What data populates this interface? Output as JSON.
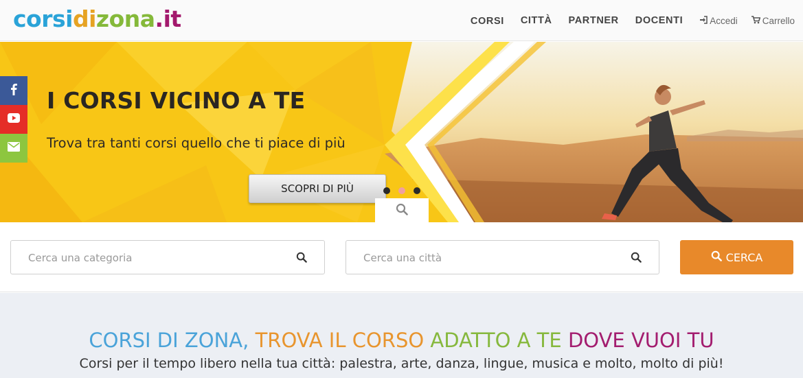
{
  "header": {
    "logo_parts": [
      "corsi",
      "di",
      "zona",
      ".it"
    ],
    "nav": [
      "CORSI",
      "CITTÀ",
      "PARTNER",
      "DOCENTI"
    ],
    "login_label": "Accedi",
    "cart_label": "Carrello"
  },
  "hero": {
    "title": "I CORSI VICINO A TE",
    "subtitle": "Trova tra tanti corsi quello che ti piace di più",
    "button": "SCOPRI DI PIÙ",
    "slide_count": 3,
    "active_slide": 2
  },
  "social": {
    "icons": [
      "facebook-icon",
      "youtube-icon",
      "mail-icon"
    ],
    "colors": [
      "#3b5998",
      "#e52d27",
      "#8dc63f"
    ]
  },
  "search": {
    "category_placeholder": "Cerca una categoria",
    "city_placeholder": "Cerca una città",
    "button": "CERCA",
    "button_color": "#e8892a"
  },
  "intro": {
    "title_parts": [
      "CORSI DI ZONA, ",
      "TROVA IL CORSO ",
      "ADATTO A TE ",
      "DOVE VUOI TU"
    ],
    "subtitle": "Corsi per il tempo libero nella tua città: palestra, arte, danza, lingue, musica e molto, molto di più!"
  }
}
